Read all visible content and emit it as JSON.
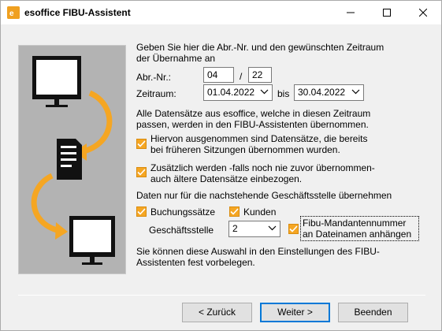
{
  "window": {
    "title": "esoffice FIBU-Assistent"
  },
  "intro": {
    "line1": "Geben Sie hier die Abr.-Nr. und den gewünschten Zeitraum",
    "line2": "der Übernahme an"
  },
  "abrnr": {
    "label": "Abr.-Nr.:",
    "value1": "04",
    "separator": "/",
    "value2": "22"
  },
  "zeitraum": {
    "label": "Zeitraum:",
    "from": "01.04.2022",
    "bis_label": "bis",
    "to": "30.04.2022"
  },
  "info": {
    "line1": "Alle Datensätze aus esoffice, welche in diesen Zeitraum",
    "line2": "passen, werden in den FIBU-Assistenten übernommen."
  },
  "check1": {
    "line1": "Hiervon ausgenommen sind Datensätze, die bereits",
    "line2": "bei früheren Sitzungen übernommen wurden.",
    "checked": true
  },
  "check2": {
    "line1": "Zusätzlich werden -falls noch nie zuvor übernommen-",
    "line2": "auch ältere Datensätze einbezogen.",
    "checked": true
  },
  "branch": {
    "heading": "Daten nur für die nachstehende Geschäftsstelle übernehmen"
  },
  "buchungssaetze": {
    "label": "Buchungssätze",
    "checked": true
  },
  "kunden": {
    "label": "Kunden",
    "checked": true
  },
  "geschaeftsstelle": {
    "label": "Geschäftsstelle",
    "value": "2"
  },
  "fibu_mandant": {
    "line1": "Fibu-Mandantennummer",
    "line2": "an Dateinamen anhängen",
    "checked": true
  },
  "footer_note": {
    "line1": "Sie können diese Auswahl in den Einstellungen des FIBU-",
    "line2": "Assistenten fest vorbelegen."
  },
  "buttons": {
    "back": "< Zurück",
    "next": "Weiter >",
    "finish": "Beenden"
  },
  "colors": {
    "accent_orange": "#f5a623",
    "art_background": "#b3b3b3"
  },
  "icons": [
    "monitor-icon",
    "document-icon",
    "curved-arrow-icon",
    "checkmark-icon",
    "chevron-down-icon"
  ]
}
